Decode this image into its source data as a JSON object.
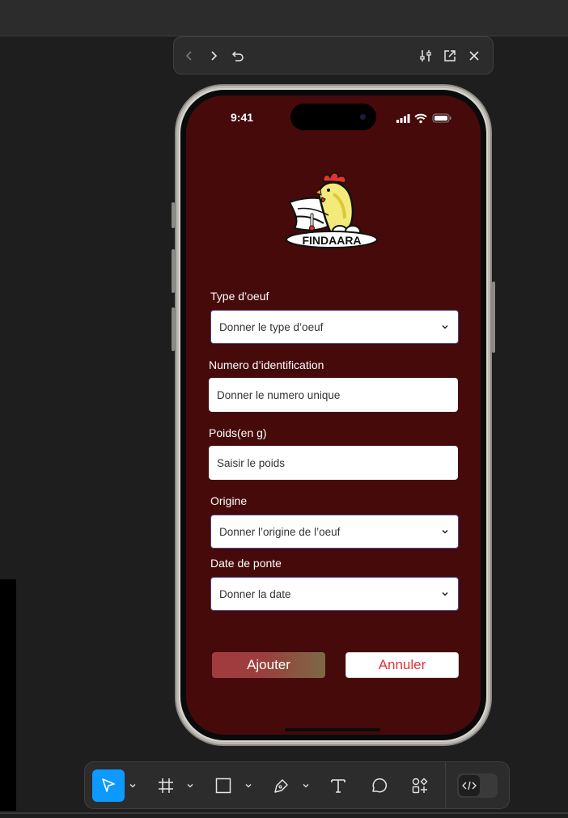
{
  "status_bar": {
    "time": "9:41"
  },
  "logo": {
    "text": "FINDAARA"
  },
  "form": {
    "type_label": "Type d’oeuf",
    "type_placeholder": "Donner le type d’oeuf",
    "id_label": "Numero d’identification",
    "id_placeholder": "Donner le numero unique",
    "weight_label": "Poids(en g)",
    "weight_placeholder": "Saisir le poids",
    "origin_label": "Origine",
    "origin_placeholder": "Donner l’origine de l’oeuf",
    "date_label": "Date de ponte",
    "date_placeholder": "Donner  la date"
  },
  "buttons": {
    "add": "Ajouter",
    "cancel": "Annuler"
  },
  "colors": {
    "screen_bg": "#460a0b",
    "add_button": "#a23b3f",
    "cancel_text": "#e0343a",
    "tool_active": "#0d99ff"
  },
  "prototype_toolbar": [
    "back-icon",
    "forward-icon",
    "restart-icon",
    "settings-sliders-icon",
    "open-external-icon",
    "close-icon"
  ],
  "design_toolbar": [
    "move-icon",
    "frame-icon",
    "rectangle-icon",
    "pen-icon",
    "text-icon",
    "comment-icon",
    "actions-icon",
    "dev-mode-icon"
  ]
}
